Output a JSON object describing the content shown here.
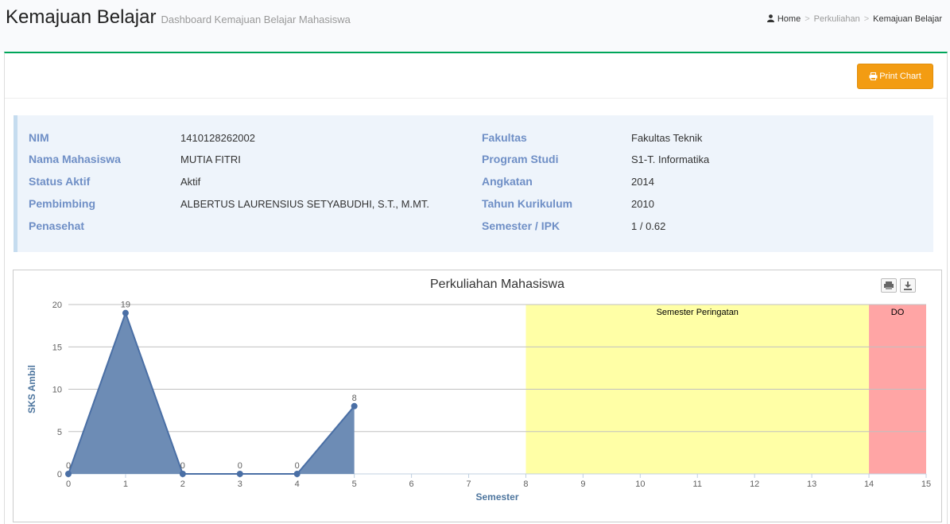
{
  "header": {
    "title": "Kemajuan Belajar",
    "subtitle": "Dashboard Kemajuan Belajar Mahasiswa",
    "breadcrumb": [
      "Home",
      "Perkuliahan",
      "Kemajuan Belajar"
    ]
  },
  "toolbar": {
    "print_label": "Print Chart"
  },
  "student": {
    "left": [
      {
        "label": "NIM",
        "value": "1410128262002"
      },
      {
        "label": "Nama Mahasiswa",
        "value": "MUTIA FITRI"
      },
      {
        "label": "Status Aktif",
        "value": "Aktif"
      },
      {
        "label": "Pembimbing",
        "value": "ALBERTUS LAURENSIUS SETYABUDHI, S.T., M.MT."
      },
      {
        "label": "Penasehat",
        "value": ""
      }
    ],
    "right": [
      {
        "label": "Fakultas",
        "value": "Fakultas Teknik"
      },
      {
        "label": "Program Studi",
        "value": "S1-T. Informatika"
      },
      {
        "label": "Angkatan",
        "value": "2014"
      },
      {
        "label": "Tahun Kurikulum",
        "value": "2010"
      },
      {
        "label": "Semester / IPK",
        "value": "1 / 0.62"
      }
    ]
  },
  "chart_data": {
    "type": "area",
    "title": "Perkuliahan Mahasiswa",
    "xlabel": "Semester",
    "ylabel": "SKS Ambil",
    "xlim": [
      0,
      15
    ],
    "ylim": [
      0,
      20
    ],
    "x_ticks": [
      0,
      1,
      2,
      3,
      4,
      5,
      6,
      7,
      8,
      9,
      10,
      11,
      12,
      13,
      14,
      15
    ],
    "y_ticks": [
      0,
      5,
      10,
      15,
      20
    ],
    "grid": true,
    "series": [
      {
        "x": [
          0,
          1,
          2,
          3,
          4,
          5
        ],
        "values": [
          0,
          19,
          0,
          0,
          0,
          8
        ],
        "data_labels": true
      }
    ],
    "bands": [
      {
        "label": "Semester Peringatan",
        "from": 8,
        "to": 14,
        "color": "#ffffa6"
      },
      {
        "label": "DO",
        "from": 14,
        "to": 15,
        "color": "#ffa5a5"
      }
    ],
    "colors": {
      "fill": "#6d8cb5",
      "line": "#4a6fa5"
    }
  }
}
